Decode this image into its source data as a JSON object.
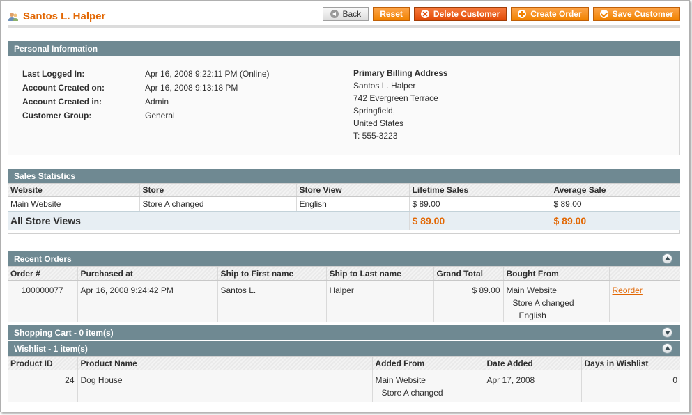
{
  "header": {
    "title": "Santos L. Halper",
    "icon": "customer-icon",
    "buttons": {
      "back": "Back",
      "reset": "Reset",
      "delete": "Delete Customer",
      "create_order": "Create Order",
      "save": "Save Customer"
    }
  },
  "personal": {
    "title": "Personal Information",
    "rows": [
      {
        "label": "Last Logged In:",
        "value": "Apr 16, 2008 9:22:11 PM (Online)"
      },
      {
        "label": "Account Created on:",
        "value": "Apr 16, 2008 9:13:18 PM"
      },
      {
        "label": "Account Created in:",
        "value": "Admin"
      },
      {
        "label": "Customer Group:",
        "value": "General"
      }
    ],
    "billing": {
      "title": "Primary Billing Address",
      "lines": [
        "Santos L. Halper",
        "742 Evergreen Terrace",
        "Springfield,",
        "United States",
        "T: 555-3223"
      ]
    }
  },
  "sales": {
    "title": "Sales Statistics",
    "headers": [
      "Website",
      "Store",
      "Store View",
      "Lifetime Sales",
      "Average Sale"
    ],
    "row": [
      "Main Website",
      "Store A changed",
      "English",
      "$ 89.00",
      "$ 89.00"
    ],
    "total_label": "All Store Views",
    "total_lifetime": "$ 89.00",
    "total_average": "$ 89.00"
  },
  "orders": {
    "title": "Recent Orders",
    "headers": [
      "Order #",
      "Purchased at",
      "Ship to First name",
      "Ship to Last name",
      "Grand Total",
      "Bought From",
      ""
    ],
    "row": {
      "order": "100000077",
      "purchased": "Apr 16, 2008 9:24:42 PM",
      "first": "Santos L.",
      "last": "Halper",
      "total": "$ 89.00",
      "website": "Main Website",
      "store": "Store A changed",
      "view": "English",
      "action": "Reorder"
    }
  },
  "cart": {
    "title": "Shopping Cart - 0 item(s)"
  },
  "wishlist": {
    "title": "Wishlist - 1 item(s)",
    "headers": [
      "Product ID",
      "Product Name",
      "Added From",
      "Date Added",
      "Days in Wishlist"
    ],
    "row": {
      "id": "24",
      "name": "Dog House",
      "website": "Main Website",
      "store": "Store A changed",
      "date": "Apr 17, 2008",
      "days": "0"
    }
  },
  "colors": {
    "accent": "#e26703",
    "section_header": "#6f8992",
    "button": "#f18200"
  }
}
